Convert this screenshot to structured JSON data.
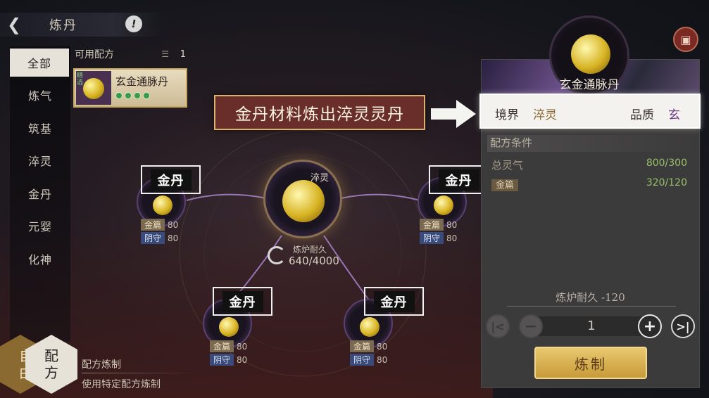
{
  "header": {
    "title": "炼丹",
    "back_icon": "back-arrow-icon",
    "info_icon": "info-icon"
  },
  "sidebar": {
    "items": [
      {
        "label": "全部",
        "active": true
      },
      {
        "label": "炼气"
      },
      {
        "label": "筑基"
      },
      {
        "label": "淬灵"
      },
      {
        "label": "金丹"
      },
      {
        "label": "元婴"
      },
      {
        "label": "化神"
      }
    ]
  },
  "recipes": {
    "header_label": "可用配方",
    "count": "1",
    "items": [
      {
        "name": "玄金通脉丹",
        "tag": "精选",
        "dots": 4
      }
    ]
  },
  "callout": {
    "text": "金丹材料炼出淬灵灵丹"
  },
  "furnace": {
    "main_label": "淬灵",
    "durability_label": "炼炉耐久",
    "durability_value": "640/4000",
    "slots": [
      {
        "label": "金丹",
        "stat1_key": "金篇",
        "stat1_val": "80",
        "stat2_key": "阴守",
        "stat2_val": "80"
      },
      {
        "label": "金丹",
        "stat1_key": "金篇",
        "stat1_val": "80",
        "stat2_key": "阴守",
        "stat2_val": "80"
      },
      {
        "label": "金丹",
        "stat1_key": "金篇",
        "stat1_val": "80",
        "stat2_key": "阴守",
        "stat2_val": "80"
      },
      {
        "label": "金丹",
        "stat1_key": "金篇",
        "stat1_val": "80",
        "stat2_key": "阴守",
        "stat2_val": "80"
      }
    ]
  },
  "mode": {
    "free_label": "自由",
    "recipe_label": "配方",
    "title": "配方炼制",
    "subtitle": "使用特定配方炼制"
  },
  "detail": {
    "name": "玄金通脉丹",
    "realm_label": "境界",
    "realm_value": "淬灵",
    "quality_label": "品质",
    "quality_value": "玄",
    "conditions_title": "配方条件",
    "conditions": [
      {
        "key": "总灵气",
        "value": "800/300"
      },
      {
        "key": "金篇",
        "value": "320/120"
      }
    ],
    "furnace_cost": "炼炉耐久 -120",
    "quantity": "1",
    "craft_label": "炼制"
  },
  "colors": {
    "accent_gold": "#d8b424",
    "realm_value": "#8a6a30",
    "quality_value": "#6a3a8a",
    "condition_ok": "#9ac06a"
  }
}
